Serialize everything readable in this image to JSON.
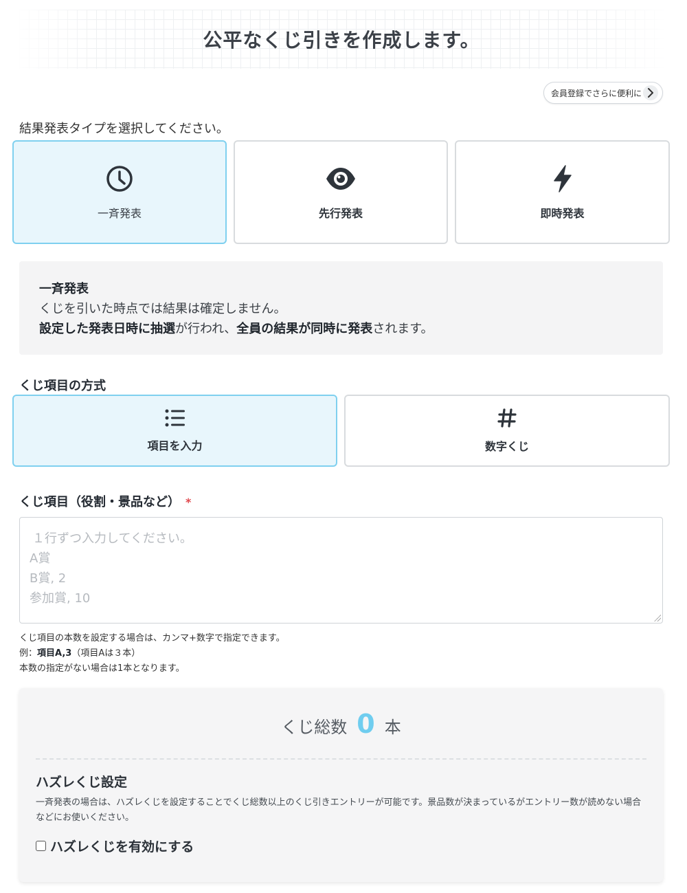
{
  "header": {
    "title": "公平なくじ引きを作成します。"
  },
  "member_button": {
    "label": "会員登録でさらに便利に"
  },
  "result_type": {
    "prompt": "結果発表タイプを選択してください。",
    "options": [
      {
        "label": "一斉発表",
        "icon": "clock-icon",
        "selected": true
      },
      {
        "label": "先行発表",
        "icon": "eye-icon",
        "selected": false
      },
      {
        "label": "即時発表",
        "icon": "bolt-icon",
        "selected": false
      }
    ]
  },
  "description": {
    "title": "一斉発表",
    "line1": "くじを引いた時点では結果は確定しません。",
    "line2_bold1": "設定した発表日時に抽選",
    "line2_text1": "が行われ、",
    "line2_bold2": "全員の結果が同時に発表",
    "line2_text2": "されます。"
  },
  "method": {
    "label": "くじ項目の方式",
    "options": [
      {
        "label": "項目を入力",
        "icon": "list-icon",
        "selected": true
      },
      {
        "label": "数字くじ",
        "icon": "hash-icon",
        "selected": false
      }
    ]
  },
  "items_field": {
    "label": "くじ項目（役割・景品など）",
    "required_mark": "*",
    "placeholder_lines": [
      "１行ずつ入力してください。",
      "A賞",
      "B賞, 2",
      "参加賞, 10"
    ],
    "help_line1": "くじ項目の本数を設定する場合は、カンマ+数字で指定できます。",
    "help_example_prefix": "例：",
    "help_example_bold": "項目A,3",
    "help_example_suffix": "（項目Aは３本）",
    "help_line3": "本数の指定がない場合は1本となります。"
  },
  "summary": {
    "total_label": "くじ総数",
    "total_count": "0",
    "total_unit": "本",
    "hazure_title": "ハズレくじ設定",
    "hazure_desc": "一斉発表の場合は、ハズレくじを設定することでくじ総数以上のくじ引きエントリーが可能です。景品数が決まっているがエントリー数が読めない場合などにお使いください。",
    "hazure_checkbox_label": "ハズレくじを有効にする",
    "hazure_checked": false
  },
  "colors": {
    "selected_border": "#7fd0ef",
    "selected_bg": "#e8f6fc",
    "accent_count": "#6fcdef",
    "required": "#e0474c"
  }
}
